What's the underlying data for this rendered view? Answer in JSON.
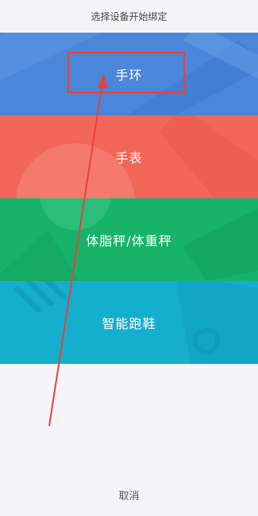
{
  "header": {
    "title": "选择设备开始绑定"
  },
  "devices": [
    {
      "label": "手环",
      "color": "#4a86d9"
    },
    {
      "label": "手表",
      "color": "#f2675a"
    },
    {
      "label": "体脂秤/体重秤",
      "color": "#17b36a"
    },
    {
      "label": "智能跑鞋",
      "color": "#15aecd"
    }
  ],
  "annotation": {
    "color": "#e8413a"
  },
  "footer": {
    "cancel_label": "取消"
  }
}
